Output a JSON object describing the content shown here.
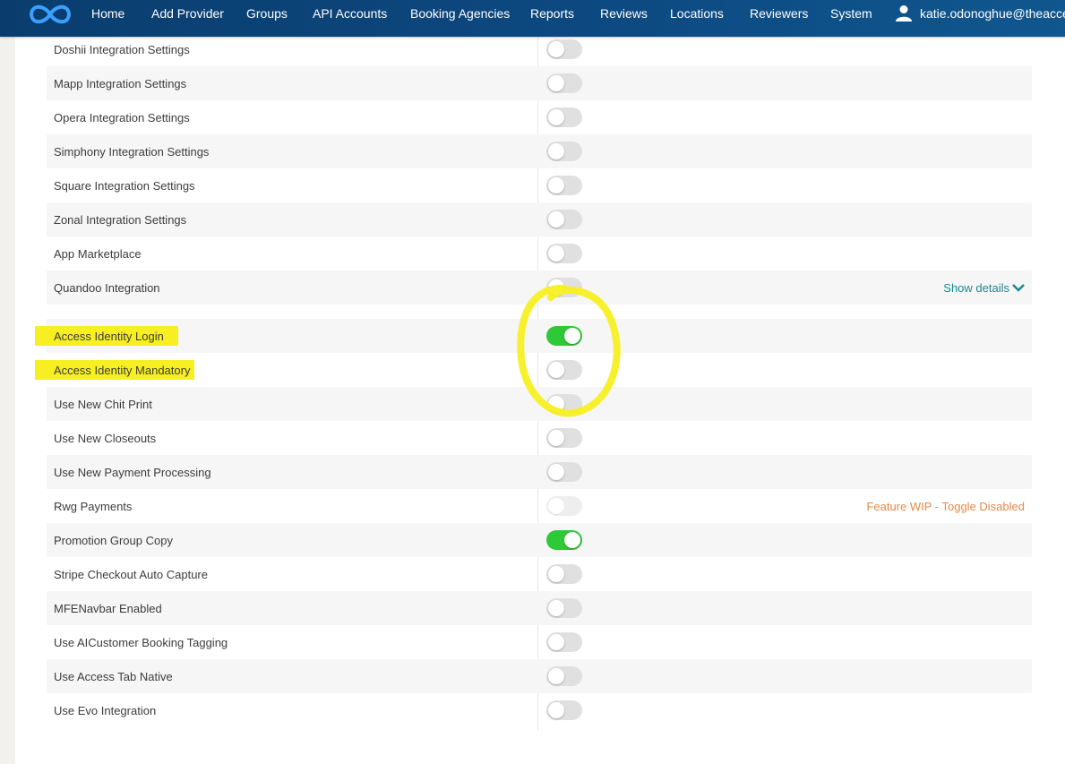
{
  "nav": {
    "items": [
      "Home",
      "Add Provider",
      "Groups",
      "API Accounts",
      "Booking Agencies",
      "Reports",
      "Reviews",
      "Locations",
      "Reviewers",
      "System"
    ],
    "user_email": "katie.odonoghue@theacces"
  },
  "settings": {
    "rows": [
      {
        "label": "Doshii Integration Settings",
        "state": "off"
      },
      {
        "label": "Mapp Integration Settings",
        "state": "off"
      },
      {
        "label": "Opera Integration Settings",
        "state": "off"
      },
      {
        "label": "Simphony Integration Settings",
        "state": "off"
      },
      {
        "label": "Square Integration Settings",
        "state": "off"
      },
      {
        "label": "Zonal Integration Settings",
        "state": "off"
      },
      {
        "label": "App Marketplace",
        "state": "off"
      },
      {
        "label": "Quandoo Integration",
        "state": "off",
        "link": "Show details"
      },
      {
        "label": "Access Identity Login",
        "state": "on",
        "highlighted": true
      },
      {
        "label": "Access Identity Mandatory",
        "state": "off",
        "highlighted": true
      },
      {
        "label": "Use New Chit Print",
        "state": "off"
      },
      {
        "label": "Use New Closeouts",
        "state": "off"
      },
      {
        "label": "Use New Payment Processing",
        "state": "off"
      },
      {
        "label": "Rwg Payments",
        "state": "disabled",
        "note": "Feature WIP - Toggle Disabled"
      },
      {
        "label": "Promotion Group Copy",
        "state": "on"
      },
      {
        "label": "Stripe Checkout Auto Capture",
        "state": "off"
      },
      {
        "label": "MFENavbar Enabled",
        "state": "off"
      },
      {
        "label": "Use AICustomer Booking Tagging",
        "state": "off"
      },
      {
        "label": "Use Access Tab Native",
        "state": "off"
      },
      {
        "label": "Use Evo Integration",
        "state": "off"
      }
    ]
  },
  "colors": {
    "navbar": "#0d4a82",
    "toggle_on": "#2dc937",
    "toggle_off": "#e0e0e0",
    "link": "#1a8a8f",
    "note": "#e68a48",
    "highlighter": "#f7ef21"
  },
  "icons": {
    "logo": "infinity-logo-icon",
    "user": "user-icon",
    "details": "chevron-down-icon"
  }
}
